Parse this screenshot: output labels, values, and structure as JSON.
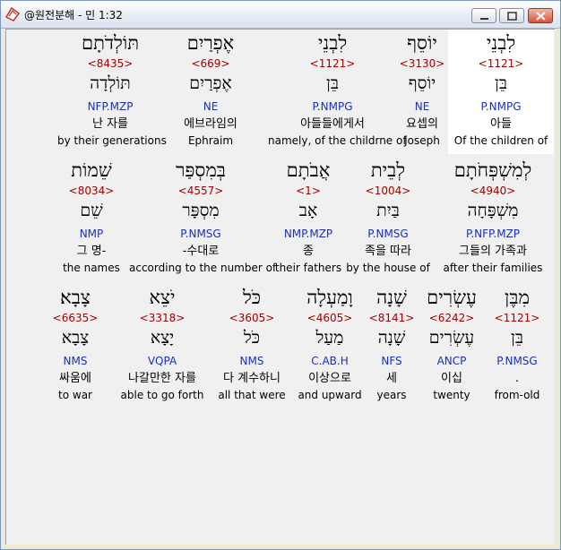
{
  "window": {
    "title": "@원전분해 - 민 1:32",
    "icon": "app-logo-icon"
  },
  "rows": [
    {
      "words": [
        {
          "heb": "לִבְנֵי",
          "strong": "<1121>",
          "root": "בֵּן",
          "morph": "P.NMPG",
          "korean": "아들",
          "english": "Of the children of",
          "highlight": true
        },
        {
          "heb": "יוֹסֵף",
          "strong": "<3130>",
          "root": "יוֹסֵף",
          "morph": "NE",
          "korean": "요셉의",
          "english": "Joseph",
          "highlight": false
        },
        {
          "heb": "לִבְנֵי",
          "strong": "<1121>",
          "root": "בֵּן",
          "morph": "P.NMPG",
          "korean": "아들들에게서",
          "english": "namely, of the childrne of",
          "highlight": false
        },
        {
          "heb": "אֶפְרַיִם",
          "strong": "<669>",
          "root": "אֶפְרַיִם",
          "morph": "NE",
          "korean": "에브라임의",
          "english": "Ephraim",
          "highlight": false
        },
        {
          "heb": "תּוֹלְדֹתָם",
          "strong": "<8435>",
          "root": "תּוֹלְדָה",
          "morph": "NFP.MZP",
          "korean": "난 자를",
          "english": "by their generations",
          "highlight": false
        }
      ]
    },
    {
      "words": [
        {
          "heb": "לְמִשְׁפְּחֹתָם",
          "strong": "<4940>",
          "root": "מִשְׁפָּחָה",
          "morph": "P.NFP.MZP",
          "korean": "그들의 가족과",
          "english": "after their families",
          "highlight": false
        },
        {
          "heb": "לְבֵית",
          "strong": "<1004>",
          "root": "בַּיִת",
          "morph": "P.NMSG",
          "korean": "족을 따라",
          "english": "by the house of",
          "highlight": false
        },
        {
          "heb": "אֲבֹתָם",
          "strong": "<1>",
          "root": "אָב",
          "morph": "NMP.MZP",
          "korean": "종",
          "english": "their fathers",
          "highlight": false
        },
        {
          "heb": "בְּמִסְפַּר",
          "strong": "<4557>",
          "root": "מִסְפָּר",
          "morph": "P.NMSG",
          "korean": "-수대로",
          "english": "according to the number of",
          "highlight": false
        },
        {
          "heb": "שֵׁמוֹת",
          "strong": "<8034>",
          "root": "שֵׁם",
          "morph": "NMP",
          "korean": "그 명-",
          "english": "the names",
          "highlight": false
        }
      ]
    },
    {
      "words": [
        {
          "heb": "מִבֶּן",
          "strong": "<1121>",
          "root": "בֵּן",
          "morph": "P.NMSG",
          "korean": ".",
          "english": "from-old",
          "highlight": false
        },
        {
          "heb": "עֶשְׂרִים",
          "strong": "<6242>",
          "root": "עֶשְׂרִים",
          "morph": "ANCP",
          "korean": "이십",
          "english": "twenty",
          "highlight": false
        },
        {
          "heb": "שָׁנָה",
          "strong": "<8141>",
          "root": "שָׁנָה",
          "morph": "NFS",
          "korean": "세",
          "english": "years",
          "highlight": false
        },
        {
          "heb": "וָמַעְלָה",
          "strong": "<4605>",
          "root": "מַעַל",
          "morph": "C.AB.H",
          "korean": "이상으로",
          "english": "and upward",
          "highlight": false
        },
        {
          "heb": "כֹּל",
          "strong": "<3605>",
          "root": "כֹּל",
          "morph": "NMS",
          "korean": "다 계수하니",
          "english": "all that were",
          "highlight": false
        },
        {
          "heb": "יֹצֵא",
          "strong": "<3318>",
          "root": "יָצָא",
          "morph": "VQPA",
          "korean": "나갈만한 자를",
          "english": "able to go forth",
          "highlight": false
        },
        {
          "heb": "צָבָא׃",
          "strong": "<6635>",
          "root": "צָבָא",
          "morph": "NMS",
          "korean": "싸움에",
          "english": "to war",
          "highlight": false
        }
      ]
    }
  ],
  "colors": {
    "strong": "#a00000",
    "morph": "#1c2fb5",
    "highlight": "#ffffff",
    "background": "#f0f0f0"
  }
}
